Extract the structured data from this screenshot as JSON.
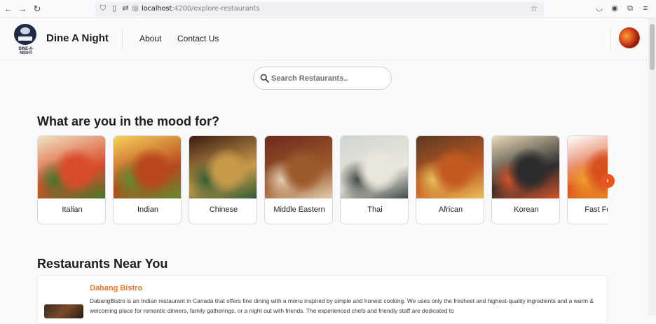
{
  "browser": {
    "url_host": "localhost",
    "url_path": ":4200/explore-restaurants"
  },
  "header": {
    "logo_caption": "DINE-A-NIGHT",
    "brand_name": "Dine A Night",
    "nav": [
      {
        "label": "About"
      },
      {
        "label": "Contact Us"
      }
    ]
  },
  "search": {
    "placeholder": "Search Restaurants.."
  },
  "mood": {
    "title": "What are you in the mood for?",
    "cuisines": [
      {
        "label": "Italian",
        "colors": [
          "#f2e3c2",
          "#d94c2a",
          "#3f7a2a"
        ]
      },
      {
        "label": "Indian",
        "colors": [
          "#f6d35a",
          "#b8471d",
          "#5f8f2e"
        ]
      },
      {
        "label": "Chinese",
        "colors": [
          "#3b1a12",
          "#c79a4a",
          "#2f5a34"
        ]
      },
      {
        "label": "Middle Eastern",
        "colors": [
          "#6e2a1c",
          "#9d5a2c",
          "#e4d0b4"
        ]
      },
      {
        "label": "Thai",
        "colors": [
          "#cfd6d0",
          "#eae6dc",
          "#3e4a44"
        ]
      },
      {
        "label": "African",
        "colors": [
          "#5a3a22",
          "#c45a22",
          "#e8c25a"
        ]
      },
      {
        "label": "Korean",
        "colors": [
          "#e9d9b6",
          "#2c2c2c",
          "#d8542a"
        ]
      },
      {
        "label": "Fast Food",
        "colors": [
          "#ffffff",
          "#d9501e",
          "#f0a22a"
        ]
      }
    ]
  },
  "restaurants": {
    "title": "Restaurants Near You",
    "items": [
      {
        "name": "Dabang Bistro",
        "description": "DabangBistro is an Indian restaurant in Canada that offers fine dining with a menu inspired by simple and honest cooking. We uses only the freshest and highest-quality ingredients and a warm & welcoming place for romantic dinners, family gatherings, or a night out with friends. The experienced chefs and friendly staff are dedicated to"
      }
    ]
  },
  "colors": {
    "accent": "#e8561d",
    "restaurant_name": "#e8782a"
  }
}
